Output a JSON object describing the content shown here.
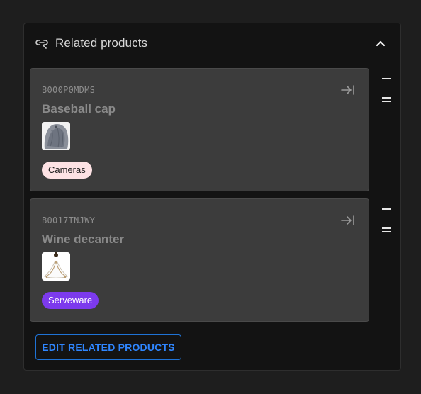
{
  "header": {
    "title": "Related products",
    "icon": "link-icon"
  },
  "products": [
    {
      "sku": "B000P0MDMS",
      "title": "Baseball cap",
      "tag": "Cameras",
      "tag_bg": "#fde2e4",
      "tag_color": "#1a1a1a",
      "thumb": "baseball-cap-image"
    },
    {
      "sku": "B0017TNJWY",
      "title": "Wine decanter",
      "tag": "Serveware",
      "tag_bg": "#7c3aed",
      "tag_color": "#ffffff",
      "thumb": "wine-decanter-image"
    }
  ],
  "footer": {
    "edit_label": "EDIT RELATED PRODUCTS"
  },
  "colors": {
    "accent": "#2f86ff",
    "panel_bg": "#131313",
    "card_bg": "#3c3c3c"
  }
}
